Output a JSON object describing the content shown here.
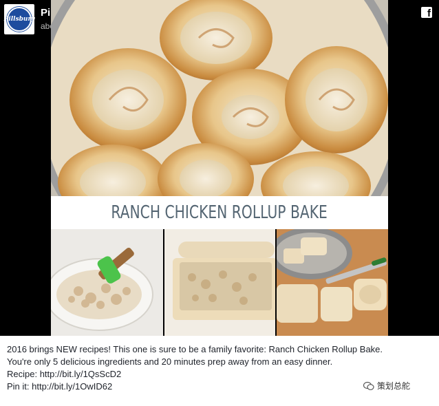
{
  "post": {
    "page_name": "Pillsbury",
    "timestamp": "about a year ago",
    "brand_logo_text": "Pillsbury",
    "verified_icon": "check-icon",
    "network_icon": "facebook-icon"
  },
  "image": {
    "title": "RANCH CHICKEN ROLLUP BAKE"
  },
  "caption": {
    "line1": "2016 brings NEW recipes! This one is sure to be a family favorite: Ranch Chicken Rollup Bake.",
    "line2": "You're only 5 delicious ingredients and 20 minutes prep away from an easy dinner.",
    "recipe_label": "Recipe: ",
    "recipe_link": "http://bit.ly/1QsScD2",
    "pin_label": "Pin it: ",
    "pin_link": "http://bit.ly/1OwID62"
  },
  "watermark": {
    "text": "策划总舵"
  },
  "colors": {
    "video_bg": "#000000",
    "brand_blue": "#1d4c9e",
    "title_text": "#556673"
  }
}
